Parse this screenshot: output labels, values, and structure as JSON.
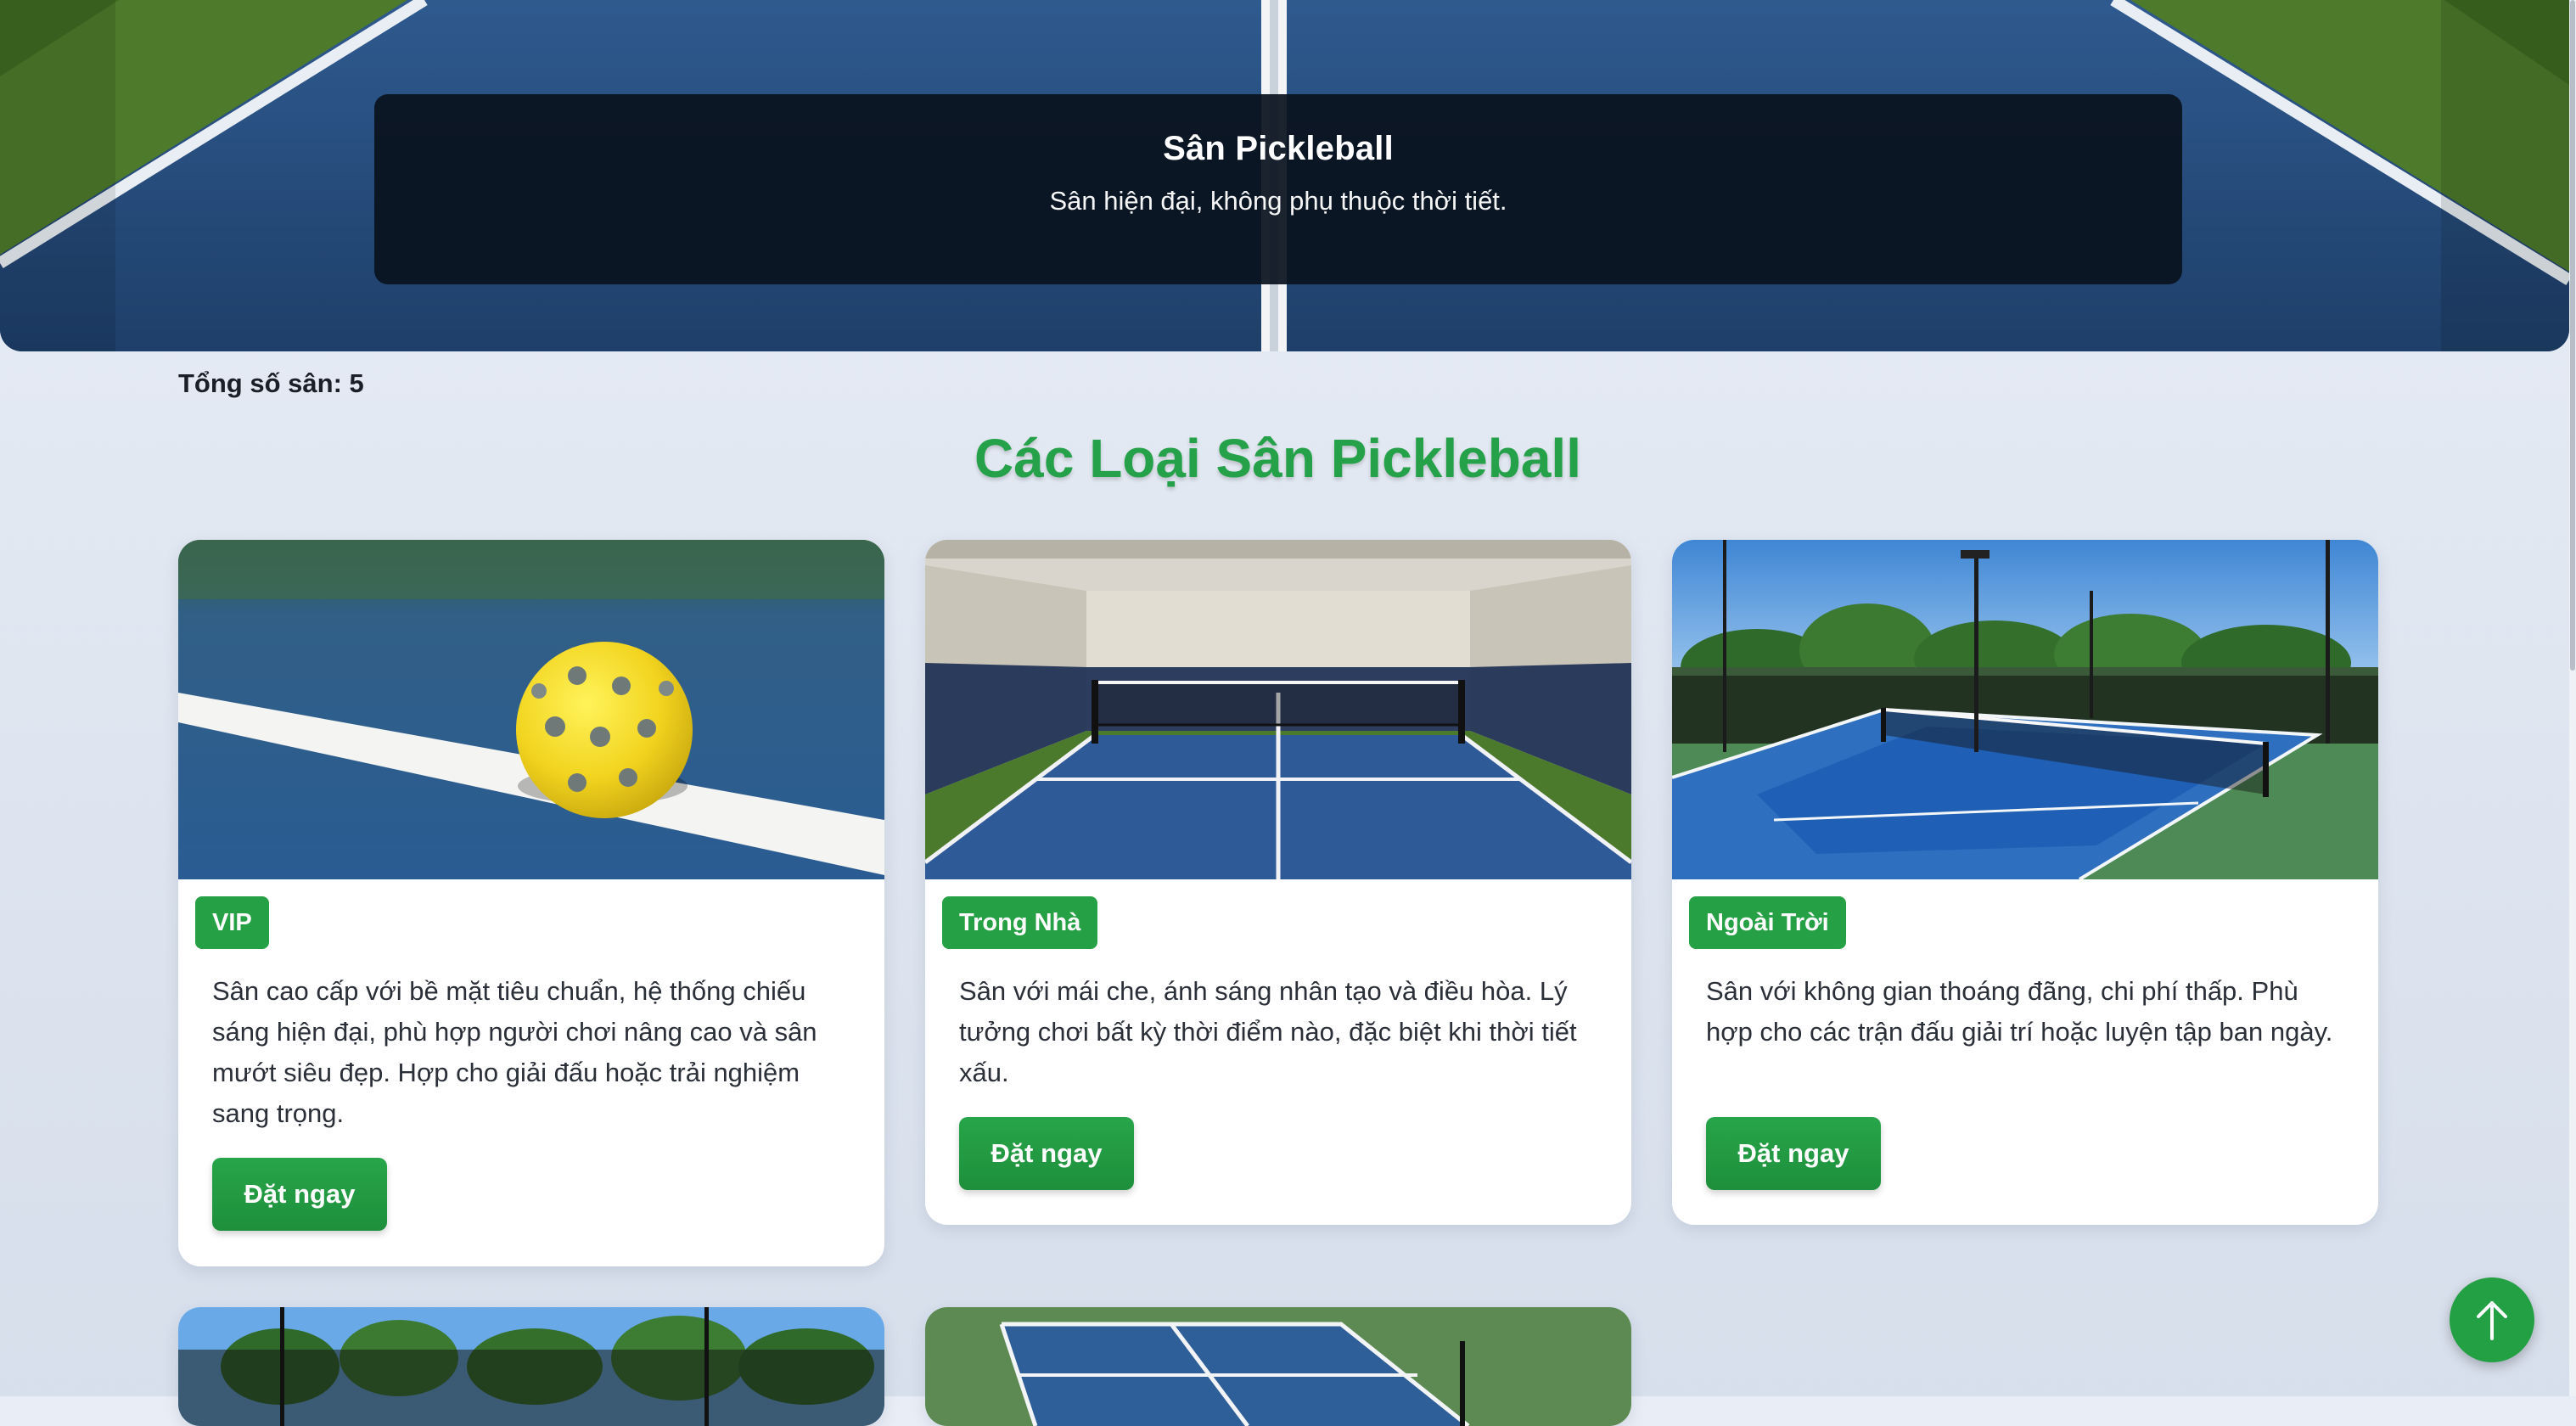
{
  "hero": {
    "title": "Sân Pickleball",
    "subtitle": "Sân hiện đại, không phụ thuộc thời tiết."
  },
  "summary": {
    "total_courts": "Tổng số sân: 5"
  },
  "section": {
    "title": "Các Loại Sân Pickleball"
  },
  "cards": [
    {
      "image": "pickleball-ball-on-blue-court",
      "badge": "VIP",
      "description": "Sân cao cấp với bề mặt tiêu chuẩn, hệ thống chiếu sáng hiện đại, phù hợp người chơi nâng cao và sân mướt siêu đẹp. Hợp cho giải đấu hoặc trải nghiệm sang trọng.",
      "button": "Đặt ngay"
    },
    {
      "image": "indoor-court-with-net",
      "badge": "Trong Nhà",
      "description": "Sân với mái che, ánh sáng nhân tạo và điều hòa. Lý tưởng chơi bất kỳ thời điểm nào, đặc biệt khi thời tiết xấu.",
      "button": "Đặt ngay"
    },
    {
      "image": "outdoor-court-with-fence",
      "badge": "Ngoài Trời",
      "description": "Sân với không gian thoáng đãng, chi phí thấp. Phù hợp cho các trận đấu giải trí hoặc luyện tập ban ngày.",
      "button": "Đặt ngay"
    },
    {
      "image": "outdoor-court-trees"
    },
    {
      "image": "court-aerial-view"
    }
  ],
  "icons": {
    "back_to_top": "arrow-up-icon"
  },
  "colors": {
    "accent_green": "#25a249",
    "hero_overlay": "#0a121e",
    "court_blue": "#2e5588"
  }
}
